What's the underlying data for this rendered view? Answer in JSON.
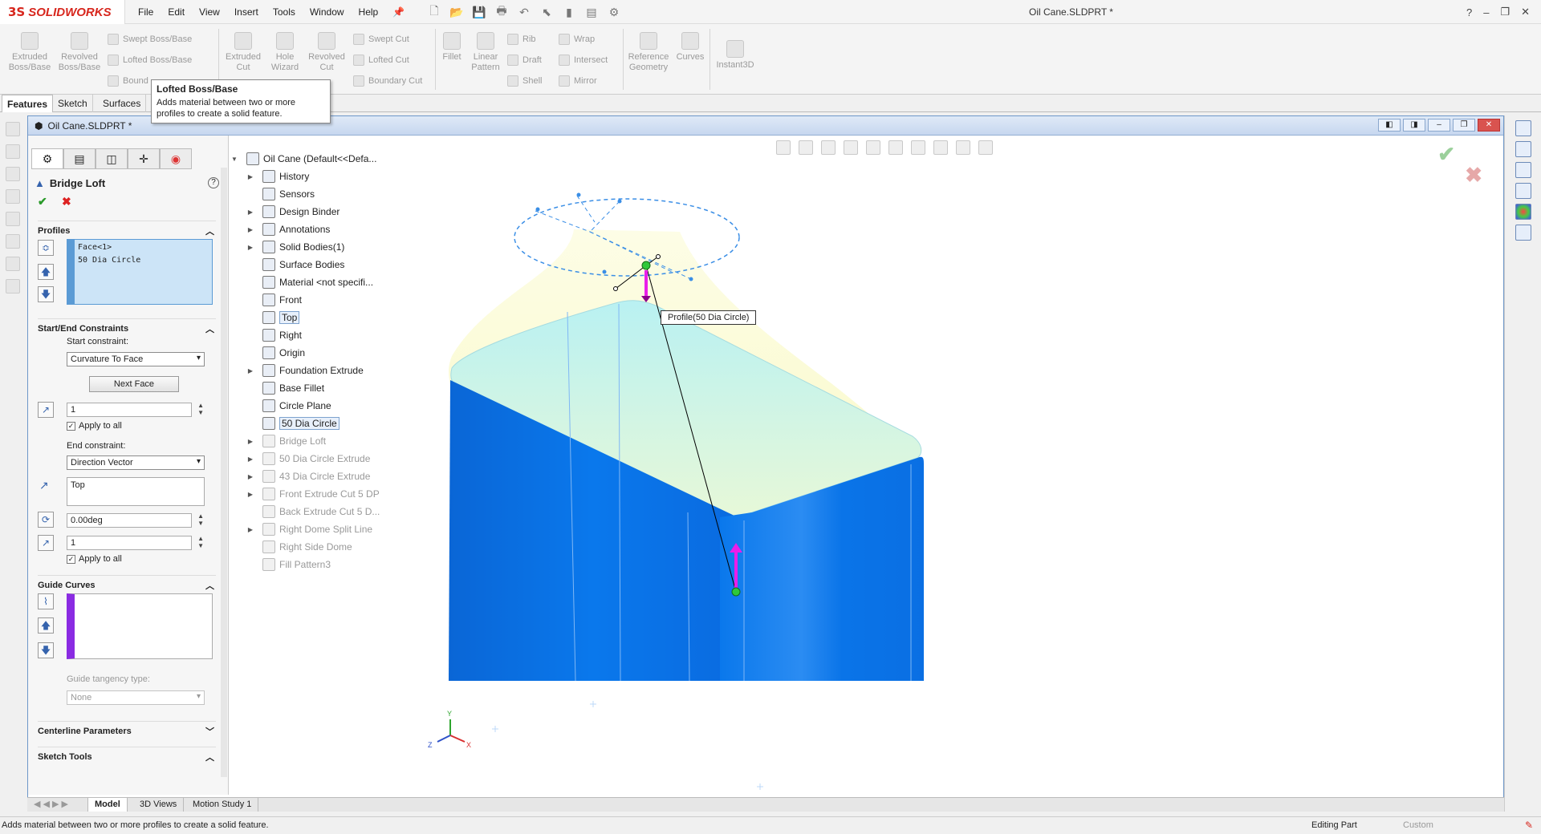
{
  "app": {
    "logo_prefix": "3S",
    "logo_name": "SOLIDWORKS",
    "doc_title": "Oil Cane.SLDPRT *"
  },
  "menu": [
    "File",
    "Edit",
    "View",
    "Insert",
    "Tools",
    "Window",
    "Help"
  ],
  "window_controls": {
    "help": "?",
    "min": "–",
    "restore": "❐",
    "close": "✕"
  },
  "ribbon": {
    "extruded_boss": "Extruded Boss/Base",
    "revolved_boss": "Revolved Boss/Base",
    "swept_boss": "Swept Boss/Base",
    "lofted_boss": "Lofted Boss/Base",
    "boundary_boss": "Bound",
    "extruded_cut": "Extruded Cut",
    "hole_wizard": "Hole Wizard",
    "revolved_cut": "Revolved Cut",
    "swept_cut": "Swept Cut",
    "lofted_cut": "Lofted Cut",
    "boundary_cut": "Boundary Cut",
    "fillet": "Fillet",
    "linear_pattern": "Linear Pattern",
    "rib": "Rib",
    "draft": "Draft",
    "shell": "Shell",
    "wrap": "Wrap",
    "intersect": "Intersect",
    "mirror": "Mirror",
    "reference_geometry": "Reference Geometry",
    "curves": "Curves",
    "instant3d": "Instant3D"
  },
  "tabs": [
    "Features",
    "Sketch",
    "Surfaces"
  ],
  "tooltip": {
    "title": "Lofted Boss/Base",
    "desc": "Adds material between two or more profiles to create a solid feature."
  },
  "docwin": {
    "title": "Oil Cane.SLDPRT *"
  },
  "pm": {
    "title": "Bridge Loft",
    "help": "?",
    "ok": "✔",
    "cancel": "✖",
    "profiles_hdr": "Profiles",
    "profile_items": [
      "Face<1>",
      "50 Dia Circle"
    ],
    "constraints_hdr": "Start/End Constraints",
    "start_lbl": "Start constraint:",
    "start_val": "Curvature To Face",
    "next_face": "Next Face",
    "start_tangent_len": "1",
    "apply_all": "Apply to all",
    "end_lbl": "End constraint:",
    "end_val": "Direction Vector",
    "dir_ref": "Top",
    "draft_angle": "0.00deg",
    "end_tangent_len": "1",
    "apply_all2": "Apply to all",
    "guide_hdr": "Guide Curves",
    "guide_tangency_lbl": "Guide tangency type:",
    "guide_tangency_val": "None",
    "centerline_hdr": "Centerline Parameters",
    "sketch_tools_hdr": "Sketch Tools"
  },
  "tree": [
    {
      "label": "Oil Cane  (Default<<Defa...",
      "expand": "▼",
      "dim": false,
      "hl": false
    },
    {
      "label": "History",
      "expand": "▶",
      "dim": false,
      "hl": false
    },
    {
      "label": "Sensors",
      "expand": "",
      "dim": false,
      "hl": false
    },
    {
      "label": "Design Binder",
      "expand": "▶",
      "dim": false,
      "hl": false
    },
    {
      "label": "Annotations",
      "expand": "▶",
      "dim": false,
      "hl": false
    },
    {
      "label": "Solid Bodies(1)",
      "expand": "▶",
      "dim": false,
      "hl": false
    },
    {
      "label": "Surface Bodies",
      "expand": "",
      "dim": false,
      "hl": false
    },
    {
      "label": "Material <not specifi...",
      "expand": "",
      "dim": false,
      "hl": false
    },
    {
      "label": "Front",
      "expand": "",
      "dim": false,
      "hl": false
    },
    {
      "label": "Top",
      "expand": "",
      "dim": false,
      "hl": true
    },
    {
      "label": "Right",
      "expand": "",
      "dim": false,
      "hl": false
    },
    {
      "label": "Origin",
      "expand": "",
      "dim": false,
      "hl": false
    },
    {
      "label": "Foundation Extrude",
      "expand": "▶",
      "dim": false,
      "hl": false
    },
    {
      "label": "Base Fillet",
      "expand": "",
      "dim": false,
      "hl": false
    },
    {
      "label": "Circle Plane",
      "expand": "",
      "dim": false,
      "hl": false
    },
    {
      "label": "50 Dia Circle",
      "expand": "",
      "dim": false,
      "hl": true
    },
    {
      "label": "Bridge Loft",
      "expand": "▶",
      "dim": true,
      "hl": false
    },
    {
      "label": "50 Dia Circle Extrude",
      "expand": "▶",
      "dim": true,
      "hl": false
    },
    {
      "label": "43 Dia Circle Extrude",
      "expand": "▶",
      "dim": true,
      "hl": false
    },
    {
      "label": "Front Extrude Cut 5 DP",
      "expand": "▶",
      "dim": true,
      "hl": false
    },
    {
      "label": "Back Extrude Cut 5 D...",
      "expand": "",
      "dim": true,
      "hl": false
    },
    {
      "label": "Right Dome Split Line",
      "expand": "▶",
      "dim": true,
      "hl": false
    },
    {
      "label": "Right Side Dome",
      "expand": "",
      "dim": true,
      "hl": false
    },
    {
      "label": "Fill Pattern3",
      "expand": "",
      "dim": true,
      "hl": false
    }
  ],
  "viewport": {
    "profile_callout": "Profile(50 Dia Circle)",
    "triad_x": "X",
    "triad_y": "Y",
    "triad_z": "Z",
    "ok": "✔",
    "cancel": "✖"
  },
  "bottom_tabs": [
    "Model",
    "3D Views",
    "Motion Study 1"
  ],
  "status": {
    "message": "Adds material between two or more profiles to create a solid feature.",
    "editing": "Editing Part",
    "custom": "Custom"
  },
  "colors": {
    "accent": "#d7261d",
    "body_blue": "#0a78ec",
    "loft_yellow": "#fbfbd0",
    "highlight": "#cce4f7",
    "guide_purple": "#8a2be2"
  }
}
